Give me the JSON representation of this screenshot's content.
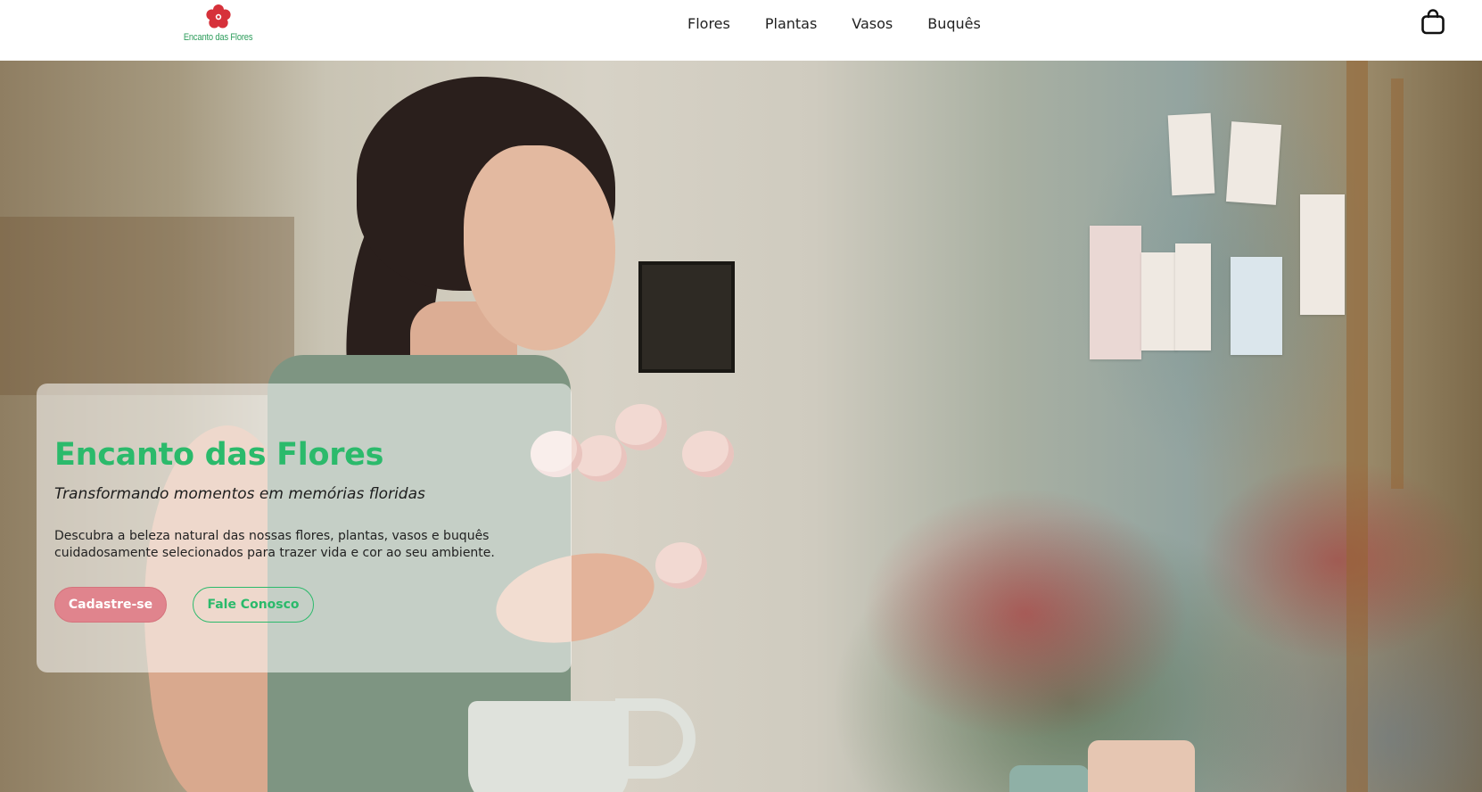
{
  "header": {
    "logo_text": "Encanto das Flores",
    "nav": [
      {
        "label": "Flores"
      },
      {
        "label": "Plantas"
      },
      {
        "label": "Vasos"
      },
      {
        "label": "Buquês"
      }
    ],
    "cart_icon": "shopping-bag-icon"
  },
  "hero": {
    "title": "Encanto das Flores",
    "subtitle": "Transformando momentos em memórias floridas",
    "description": "Descubra a beleza natural das nossas flores, plantas, vasos e buquês cuidadosamente selecionados para trazer vida e cor ao seu ambiente.",
    "primary_button": "Cadastre-se",
    "secondary_button": "Fale Conosco"
  },
  "colors": {
    "accent_green": "#2bba6b",
    "accent_pink": "#e0848d",
    "logo_red": "#d6313a"
  }
}
